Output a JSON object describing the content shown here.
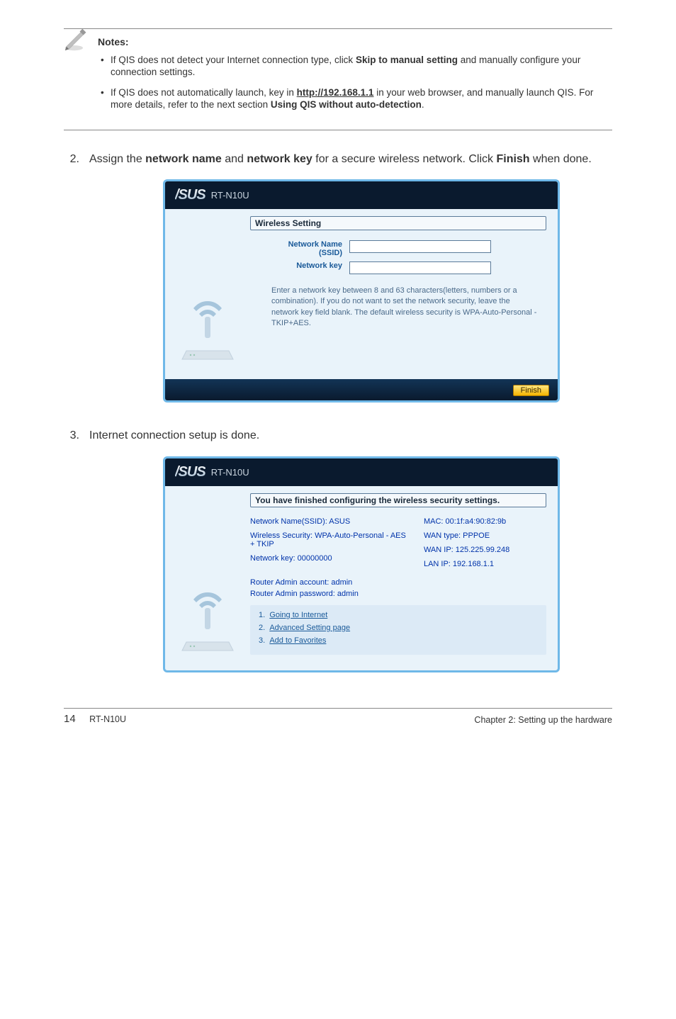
{
  "notes": {
    "title": "Notes:",
    "items": [
      {
        "pre": "If QIS does not detect your Internet connection type, click ",
        "bold": "Skip to manual setting",
        "post": " and manually configure your connection settings."
      },
      {
        "pre": "If QIS does not automatically launch, key in ",
        "link": "http://192.168.1.1",
        "mid": " in your web browser, and manually launch QIS. For more details, refer to the next section ",
        "bold": "Using QIS without auto-detection",
        "post": "."
      }
    ]
  },
  "step2": {
    "num": "2.",
    "pre": "Assign the ",
    "b1": "network name",
    "mid1": " and ",
    "b2": "network key",
    "mid2": " for a secure wireless network. Click ",
    "b3": "Finish",
    "post": " when done."
  },
  "step3": {
    "num": "3.",
    "text": "Internet connection setup is done."
  },
  "shot1": {
    "model": "RT-N10U",
    "panel_title": "Wireless Setting",
    "label_name_line1": "Network Name",
    "label_name_line2": "(SSID)",
    "label_key": "Network key",
    "hint": "Enter a network key between 8 and 63 characters(letters, numbers or a combination). If you do not want to set the network security, leave the network key field blank. The default wireless security is WPA-Auto-Personal - TKIP+AES.",
    "finish": "Finish"
  },
  "shot2": {
    "model": "RT-N10U",
    "panel_title": "You have finished configuring the wireless security settings.",
    "left": {
      "ssid": "Network Name(SSID): ASUS",
      "sec": "Wireless Security: WPA-Auto-Personal - AES + TKIP",
      "key": "Network key: 00000000"
    },
    "right": {
      "mac": "MAC: 00:1f:a4:90:82:9b",
      "wan": "WAN type: PPPOE",
      "wanip": "WAN IP: 125.225.99.248",
      "lanip": "LAN IP: 192.168.1.1"
    },
    "admin": {
      "acct": "Router Admin account: admin",
      "pass": "Router Admin password: admin"
    },
    "links": {
      "l1n": "1.",
      "l1": "Going to Internet",
      "l2n": "2.",
      "l2": "Advanced Setting page",
      "l3n": "3.",
      "l3": "Add to Favorites"
    }
  },
  "footer": {
    "page": "14",
    "model": "RT-N10U",
    "chapter": "Chapter 2: Setting up the hardware"
  }
}
